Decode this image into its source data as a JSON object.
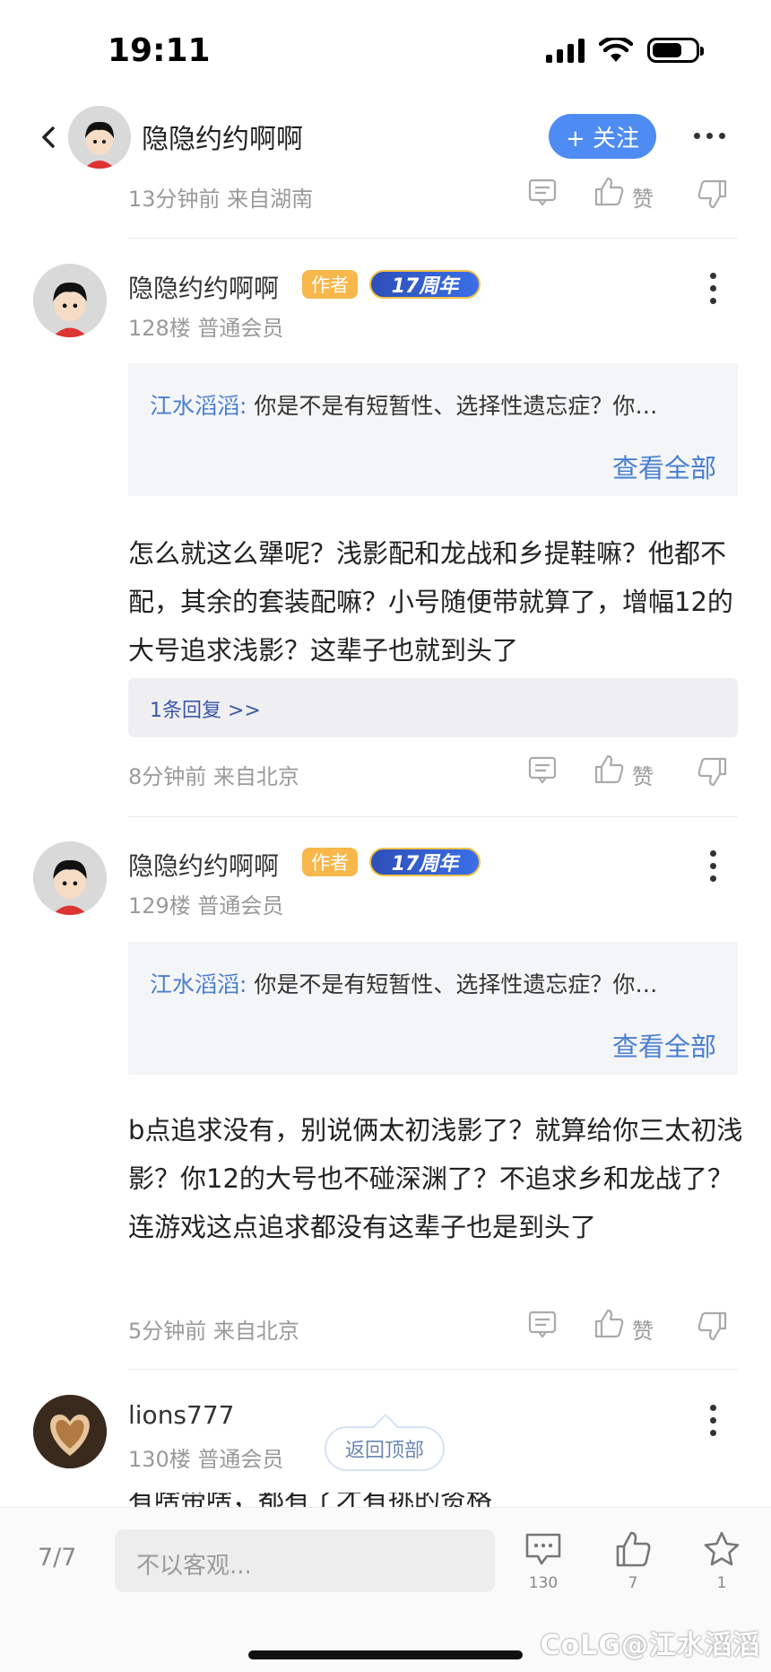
{
  "status_bar": {
    "time": "19:11"
  },
  "header": {
    "title": "隐隐约约啊啊",
    "follow_label": "+ 关注"
  },
  "top_meta": {
    "text": "13分钟前 来自湖南",
    "like_label": "赞"
  },
  "comments": [
    {
      "name": "隐隐约约啊啊",
      "author_badge": "作者",
      "anniversary_badge": "17周年",
      "floor_info": "128楼 普通会员",
      "quote_user": "江水滔滔:",
      "quote_text": " 你是不是有短暂性、选择性遗忘症？你…",
      "quote_link": "查看全部",
      "body": "怎么就这么犟呢？浅影配和龙战和乡提鞋嘛？他都不配，其余的套装配嘛？小号随便带就算了，增幅12的大号追求浅影？这辈子也就到头了",
      "reply_label": "1条回复 >>",
      "meta": "8分钟前 来自北京",
      "like_label": "赞"
    },
    {
      "name": "隐隐约约啊啊",
      "author_badge": "作者",
      "anniversary_badge": "17周年",
      "floor_info": "129楼 普通会员",
      "quote_user": "江水滔滔:",
      "quote_text": " 你是不是有短暂性、选择性遗忘症？你…",
      "quote_link": "查看全部",
      "body": "b点追求没有，别说俩太初浅影了？就算给你三太初浅影？你12的大号也不碰深渊了？不追求乡和龙战了？连游戏这点追求都没有这辈子也是到头了",
      "meta": "5分钟前 来自北京",
      "like_label": "赞"
    },
    {
      "name": "lions777",
      "floor_info": "130楼 普通会员",
      "partial_body": "有啥带啥，都有了才有挑的资格"
    }
  ],
  "back_to_top": "返回顶部",
  "bottom_bar": {
    "page_indicator": "7/7",
    "input_placeholder": "不以客观...",
    "comment_count": "130",
    "like_count": "7",
    "favorite_count": "1"
  },
  "watermark": "CoLG@江水滔滔",
  "colors": {
    "accent": "#4e8cf3",
    "link": "#4a7fd0",
    "author_badge": "#f7b74a"
  }
}
